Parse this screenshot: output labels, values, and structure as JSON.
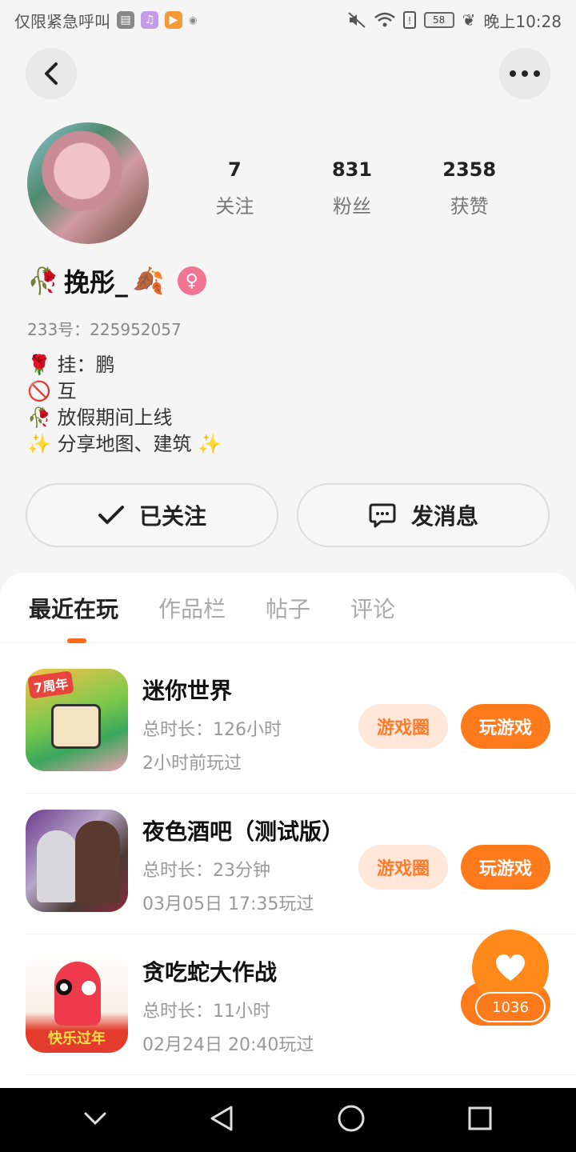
{
  "status_bar": {
    "left_text": "仅限紧急呼叫",
    "battery": "58",
    "time": "晚上10:28"
  },
  "header": {
    "back_icon": "back-arrow-icon",
    "more_icon": "more-dots-icon"
  },
  "profile": {
    "stats": [
      {
        "value": "7",
        "label": "关注"
      },
      {
        "value": "831",
        "label": "粉丝"
      },
      {
        "value": "2358",
        "label": "获赞"
      }
    ],
    "name_prefix": "🥀",
    "name": "挽彤_",
    "name_suffix": "🍂",
    "gender_symbol": "♀",
    "uid": "233号：225952057",
    "bio": [
      "🌹 挂：鹏",
      "🚫 互",
      "🥀 放假期间上线",
      "✨ 分享地图、建筑 ✨"
    ]
  },
  "actions": {
    "followed_label": "已关注",
    "message_label": "发消息"
  },
  "tabs": [
    {
      "label": "最近在玩",
      "active": true
    },
    {
      "label": "作品栏",
      "active": false
    },
    {
      "label": "帖子",
      "active": false
    },
    {
      "label": "评论",
      "active": false
    }
  ],
  "games": [
    {
      "title": "迷你世界",
      "duration": "总时长：126小时",
      "last_played": "2小时前玩过",
      "circle_label": "游戏圈",
      "play_label": "玩游戏",
      "icon_badge": "7周年"
    },
    {
      "title": "夜色酒吧（测试版）",
      "duration": "总时长：23分钟",
      "last_played": "03月05日  17:35玩过",
      "circle_label": "游戏圈",
      "play_label": "玩游戏"
    },
    {
      "title": "贪吃蛇大作战",
      "duration": "总时长：11小时",
      "last_played": "02月24日  20:40玩过",
      "icon_badge": "快乐过年"
    }
  ],
  "like": {
    "count": "1036"
  },
  "colors": {
    "accent": "#ff7a1a",
    "accent_light": "#ffe7d9",
    "gender_pink": "#f27493"
  }
}
